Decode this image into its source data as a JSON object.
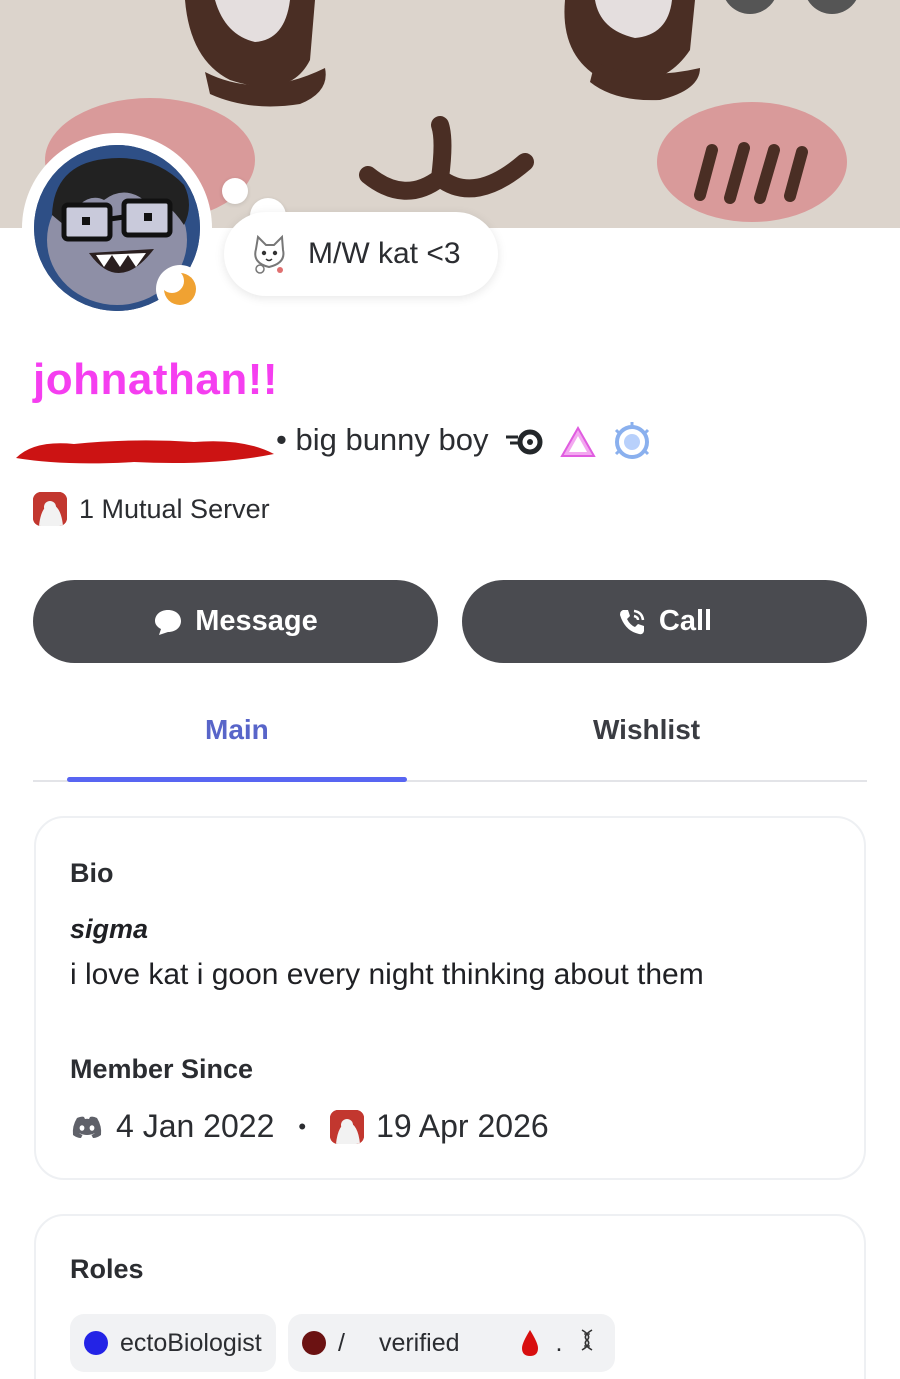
{
  "profile": {
    "display_name": "johnathan!!",
    "pronouns": "• big bunny boy",
    "custom_status": "M/W kat <3",
    "status_emoji": "cat-sticker-icon",
    "status": "idle-moon-icon",
    "badges": [
      "nitro-speed-badge-icon",
      "pink-triangle-badge-icon",
      "boost-gem-badge-icon"
    ],
    "mutual_servers": "1 Mutual Server"
  },
  "actions": {
    "message_label": "Message",
    "call_label": "Call"
  },
  "tabs": {
    "main": "Main",
    "wishlist": "Wishlist",
    "active": "Main"
  },
  "bio": {
    "title": "Bio",
    "bold_line": "sigma",
    "text": "i love kat i goon every night thinking about them"
  },
  "member_since": {
    "title": "Member Since",
    "discord_date": "4 Jan 2022",
    "separator": "•",
    "server_date": "19 Apr 2026"
  },
  "roles": {
    "title": "Roles",
    "items": [
      {
        "label": "ectoBiologist",
        "color": "#2323e6"
      },
      {
        "label": "verified",
        "prefix": "/",
        "color": "#6b1212",
        "suffix": "."
      }
    ]
  },
  "colors": {
    "accent": "#5865f2",
    "name": "#f53ef0",
    "button": "#4a4b50"
  }
}
